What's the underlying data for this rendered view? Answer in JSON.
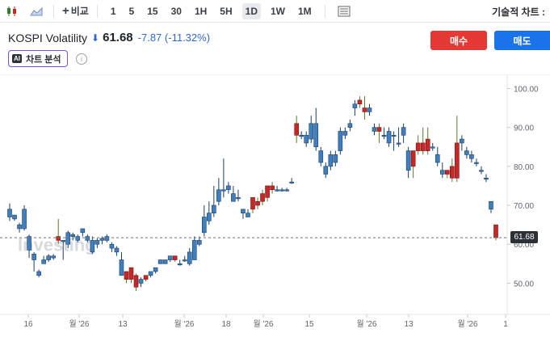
{
  "toolbar": {
    "compare_label": "비교",
    "timeframes": [
      "1",
      "5",
      "15",
      "30",
      "1H",
      "5H",
      "1D",
      "1W",
      "1M"
    ],
    "active_timeframe": "1D",
    "right_label": "기술적 차트 :"
  },
  "instrument": {
    "name": "KOSPI Volatility",
    "price": "61.68",
    "change": "-7.87",
    "change_pct": "(-11.32%)",
    "direction_icon": "arrow-down-icon"
  },
  "actions": {
    "buy_label": "매수",
    "sell_label": "매도"
  },
  "ai": {
    "badge": "AI",
    "label": "차트 분석"
  },
  "watermark": "Investing",
  "colors": {
    "up": "#1565a8",
    "down": "#c62828",
    "accent": "#2f6ad0",
    "buy": "#e53935",
    "sell": "#1a73e8"
  },
  "chart_data": {
    "type": "candlestick",
    "y_ticks": [
      "100.00",
      "90.00",
      "80.00",
      "70.00",
      "60.00",
      "50.00"
    ],
    "ylim": [
      42,
      103
    ],
    "x_ticks": [
      "16",
      "월 '26",
      "13",
      "월 '26",
      "18",
      "월 '26",
      "15",
      "월 '26",
      "13",
      "월 '26",
      "1"
    ],
    "last_price": "61.68",
    "candles": [
      [
        67,
        69,
        66,
        70.5
      ],
      [
        66.5,
        67.5,
        66,
        67.5
      ],
      [
        64,
        65,
        63,
        65.5
      ],
      [
        64,
        69,
        63.5,
        70
      ],
      [
        58.5,
        62,
        56.5,
        62.5
      ],
      [
        56,
        57.5,
        53,
        58
      ],
      [
        52,
        53,
        51.5,
        53.5
      ],
      [
        55,
        56,
        55,
        57
      ],
      [
        56,
        57,
        55.5,
        57.5
      ],
      [
        56.5,
        57,
        56,
        57.5
      ],
      [
        62,
        61,
        60,
        66.5
      ],
      [
        61,
        61,
        56,
        61
      ],
      [
        60,
        63,
        59,
        63.5
      ],
      [
        62,
        62.5,
        61,
        63
      ],
      [
        61,
        62,
        60.5,
        62.5
      ],
      [
        63,
        64,
        62,
        64
      ],
      [
        61,
        62,
        60.5,
        62.5
      ],
      [
        58,
        61,
        57.5,
        62
      ],
      [
        60,
        61,
        59,
        61.5
      ],
      [
        61,
        61.5,
        60,
        62
      ],
      [
        61,
        62,
        60.5,
        62.5
      ],
      [
        59,
        60,
        58,
        60.5
      ],
      [
        58,
        59,
        57,
        59.5
      ],
      [
        52,
        56,
        52,
        58
      ],
      [
        53,
        51,
        50,
        53
      ],
      [
        54,
        51,
        50,
        54
      ],
      [
        52,
        49,
        48,
        52.5
      ],
      [
        50,
        51,
        49,
        51.5
      ],
      [
        52,
        51,
        50.5,
        52
      ],
      [
        52,
        53,
        51.5,
        53
      ],
      [
        53,
        54,
        52.5,
        54
      ],
      [
        55,
        56,
        55,
        56
      ],
      [
        55,
        56,
        55,
        56
      ],
      [
        56,
        57,
        55.5,
        57
      ],
      [
        57,
        56,
        55.5,
        57
      ],
      [
        55,
        55,
        54.5,
        56
      ],
      [
        56,
        56,
        55.5,
        57
      ],
      [
        55,
        58,
        54.5,
        59
      ],
      [
        56,
        61,
        56,
        62
      ],
      [
        60,
        61,
        59.5,
        62
      ],
      [
        63,
        67,
        62,
        70
      ],
      [
        66,
        68,
        65,
        71
      ],
      [
        68,
        70,
        67,
        75
      ],
      [
        71,
        74,
        70,
        77
      ],
      [
        74,
        74,
        72,
        82
      ],
      [
        74,
        75,
        73,
        76
      ],
      [
        71,
        73,
        71,
        75
      ],
      [
        72,
        72,
        71,
        74
      ],
      [
        68,
        69,
        66.5,
        69
      ],
      [
        67,
        68,
        67,
        69
      ],
      [
        72,
        69,
        68,
        72
      ],
      [
        71,
        70,
        69,
        72
      ],
      [
        73,
        71,
        70,
        74
      ],
      [
        75,
        72,
        71,
        75
      ],
      [
        75,
        74,
        73,
        76
      ],
      [
        74,
        74,
        73.5,
        75
      ],
      [
        74,
        74,
        73.5,
        74.5
      ],
      [
        74,
        74,
        73.5,
        74.5
      ],
      [
        76,
        76,
        75.5,
        77
      ],
      [
        91,
        88,
        86,
        93
      ],
      [
        88,
        88,
        87,
        89
      ],
      [
        86,
        88,
        85,
        89
      ],
      [
        87,
        91,
        86,
        93
      ],
      [
        85,
        91,
        84,
        95
      ],
      [
        81,
        84,
        80,
        85
      ],
      [
        78,
        80,
        77,
        81
      ],
      [
        80,
        83,
        79,
        84
      ],
      [
        81,
        83,
        80,
        84
      ],
      [
        84,
        89,
        83,
        90
      ],
      [
        88,
        89,
        87,
        90
      ],
      [
        90,
        91,
        89,
        92
      ],
      [
        95,
        96,
        93,
        97
      ],
      [
        97,
        96,
        95,
        98
      ],
      [
        95,
        94,
        92,
        98
      ],
      [
        94,
        95,
        93,
        96
      ],
      [
        89,
        90,
        88,
        91
      ],
      [
        90,
        89,
        86,
        91
      ],
      [
        88,
        88,
        87,
        90
      ],
      [
        86,
        89,
        85,
        90
      ],
      [
        88,
        88,
        84,
        89
      ],
      [
        86,
        86,
        85,
        90
      ],
      [
        88,
        90,
        86,
        91
      ],
      [
        79,
        84,
        77,
        85
      ],
      [
        84,
        80,
        77,
        84
      ],
      [
        86,
        84,
        83,
        88
      ],
      [
        86,
        84,
        83,
        90
      ],
      [
        87,
        84,
        83,
        90
      ],
      [
        85,
        85,
        84,
        86
      ],
      [
        81,
        83,
        80,
        85
      ],
      [
        78,
        79,
        77,
        81
      ],
      [
        79,
        78,
        77,
        79
      ],
      [
        80,
        77,
        76,
        82
      ],
      [
        86,
        77,
        76,
        93
      ],
      [
        86,
        87,
        84,
        88
      ],
      [
        83,
        84,
        82,
        85
      ],
      [
        82,
        83,
        81,
        84
      ],
      [
        81,
        81,
        80,
        82
      ],
      [
        79,
        79,
        78,
        80
      ],
      [
        77,
        77,
        76,
        78
      ],
      [
        69,
        71,
        68,
        71
      ],
      [
        65,
        61.68,
        61,
        65
      ]
    ]
  }
}
